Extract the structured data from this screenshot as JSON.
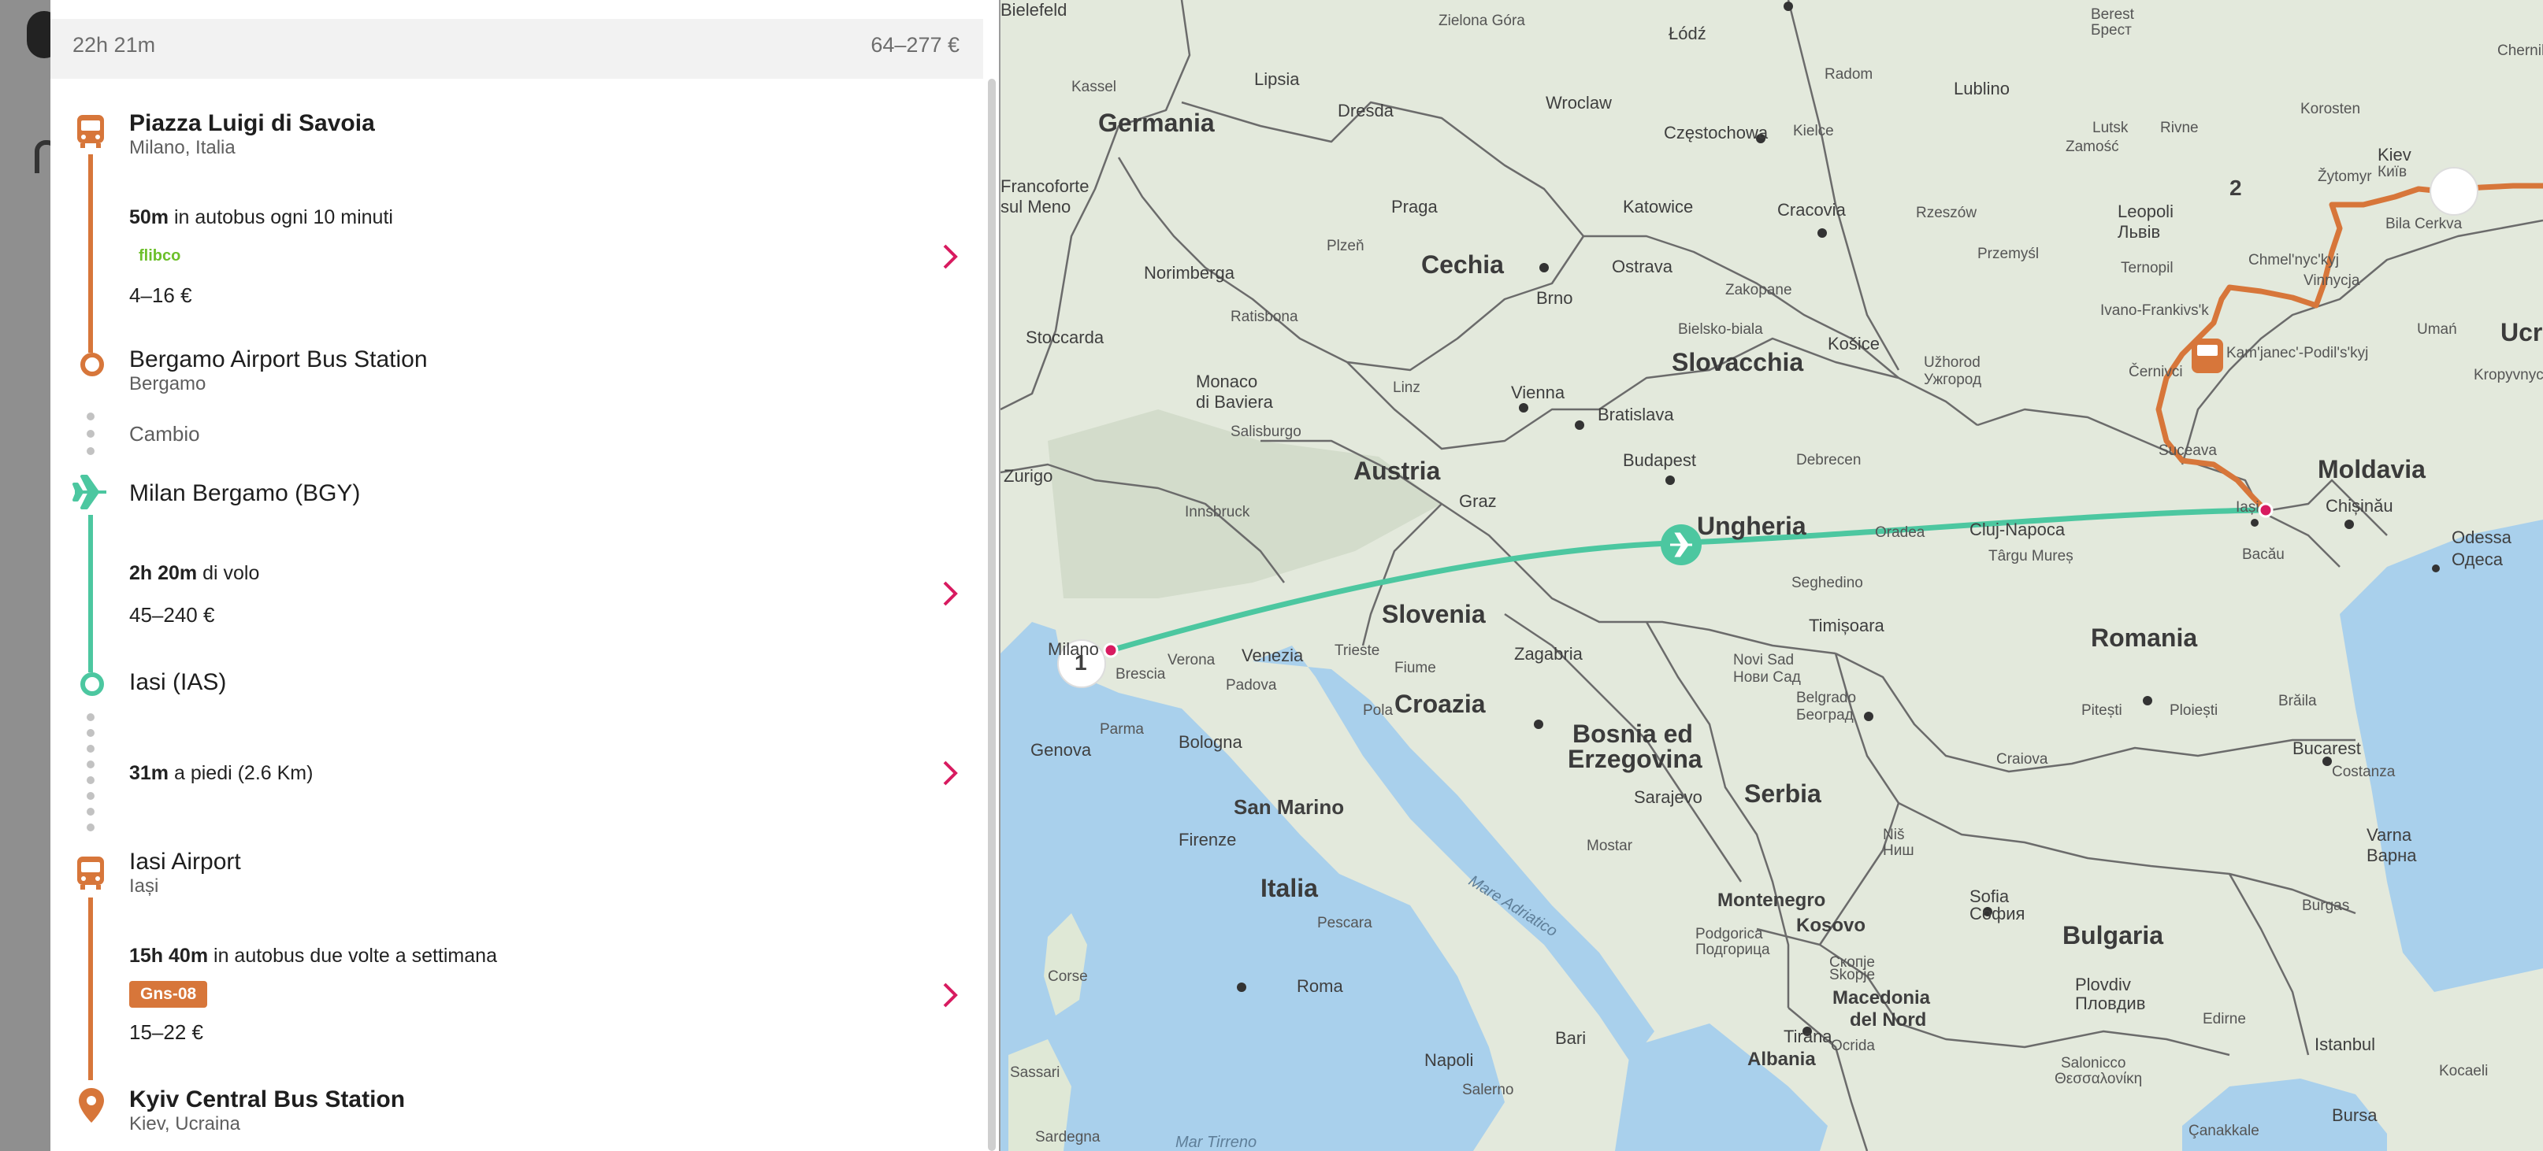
{
  "summary": {
    "duration": "22h 21m",
    "price_range": "64–277 €"
  },
  "itinerary": {
    "stop1": {
      "title": "Piazza Luigi di Savoia",
      "subtitle": "Milano, Italia"
    },
    "leg1": {
      "duration": "50m",
      "mode_text": " in autobus ogni 10 minuti",
      "operator": "flibco",
      "price": "4–16 €"
    },
    "stop2": {
      "title": "Bergamo Airport Bus Station",
      "subtitle": "Bergamo"
    },
    "transfer": {
      "label": "Cambio"
    },
    "stop3": {
      "title": "Milan Bergamo (BGY)"
    },
    "leg2": {
      "duration": "2h 20m",
      "mode_text": " di volo",
      "price": "45–240 €"
    },
    "stop4": {
      "title": "Iasi (IAS)"
    },
    "leg3": {
      "duration": "31m",
      "mode_text": " a piedi (2.6 Km)"
    },
    "stop5": {
      "title": "Iasi Airport",
      "subtitle": "Iași"
    },
    "leg4": {
      "duration": "15h 40m",
      "mode_text": " in autobus due volte a settimana",
      "operator": "Gns-08",
      "price": "15–22 €"
    },
    "stop6": {
      "title": "Kyiv Central Bus Station",
      "subtitle": "Kiev, Ucraina"
    }
  },
  "colors": {
    "bus": "#d7763a",
    "flight": "#4cc7a0",
    "chevron": "#d81b60",
    "walk": "#c2c2c2"
  },
  "icons": [
    "bus-icon",
    "plane-icon",
    "location-pin-icon",
    "chevron-right-icon"
  ],
  "map": {
    "markers": {
      "start": "1",
      "end": "2"
    },
    "countries": [
      "Germania",
      "Cechia",
      "Slovacchia",
      "Austria",
      "Ungheria",
      "Slovenia",
      "Croazia",
      "Bosnia ed",
      "Erzegovina",
      "Serbia",
      "Romania",
      "Moldavia",
      "Ucraina",
      "Bulgaria",
      "Italia",
      "San Marino",
      "Montenegro",
      "Kosovo",
      "Macedonia",
      "del Nord",
      "Albania"
    ],
    "cities": [
      "Bielefeld",
      "Zielona Góra",
      "Łódź",
      "Lipsia",
      "Dresda",
      "Wroclaw",
      "Radom",
      "Lublino",
      "Częstochowa",
      "Kielce",
      "Katowice",
      "Cracovia",
      "Rzeszów",
      "Leopoli",
      "Львів",
      "Praga",
      "Plzeň",
      "Norimberga",
      "Ratisbona",
      "Brno",
      "Ostrava",
      "Stoccarda",
      "Monaco",
      "di Baviera",
      "Linz",
      "Vienna",
      "Bratislava",
      "Košice",
      "Užhorod",
      "Ужгород",
      "Salisburgo",
      "Innsbruck",
      "Graz",
      "Budapest",
      "Debrecen",
      "Oradea",
      "Cluj-Napoca",
      "Târgu Mureș",
      "Bacău",
      "Iași",
      "Chișinău",
      "Odessa",
      "Одеса",
      "Zurigo",
      "Milano",
      "Brescia",
      "Verona",
      "Venezia",
      "Padova",
      "Trieste",
      "Fiume",
      "Zagabria",
      "Pola",
      "Seghedino",
      "Timișoara",
      "Novi Sad",
      "Нови Сад",
      "Belgrado",
      "Београд",
      "Genova",
      "Parma",
      "Bologna",
      "Firenze",
      "Pescara",
      "Roma",
      "Napoli",
      "Bari",
      "Salerno",
      "Sarajevo",
      "Mostar",
      "Podgorica",
      "Подгорица",
      "Tirana",
      "Ocrida",
      "Skopje",
      "Скопје",
      "Sofia",
      "София",
      "Niš",
      "Ниш",
      "Craiova",
      "Pitești",
      "Ploiești",
      "Bucarest",
      "Brăila",
      "Costanza",
      "Varna",
      "Варна",
      "Burgas",
      "Plovdiv",
      "Пловдив",
      "Istanbul",
      "Kiev",
      "Київ",
      "Bila Cerkva",
      "Vinnycja",
      "Chmel'nyc'kyj",
      "Ternopil",
      "Ivano-Frankivs'k",
      "Černivci",
      "Suceava",
      "Kam'janec'-Podil's'kyj",
      "Rivne",
      "Lutsk",
      "Žytomyr",
      "Korosten",
      "Umań",
      "Kropyvnyc'kyj",
      "Chernihiv",
      "Berest",
      "Брест",
      "Zamość",
      "Przemyśl",
      "Zakopane",
      "Bielsko-biala",
      "Francoforte",
      "sul Meno",
      "Kassel",
      "Sassari",
      "Corse",
      "Sardegna",
      "Salonicco",
      "Θεσσαλονίκη",
      "Bursa",
      "Kocaeli",
      "Edirne",
      "Çanakkale",
      "Mare Adriatico",
      "Mar Tirreno"
    ]
  }
}
